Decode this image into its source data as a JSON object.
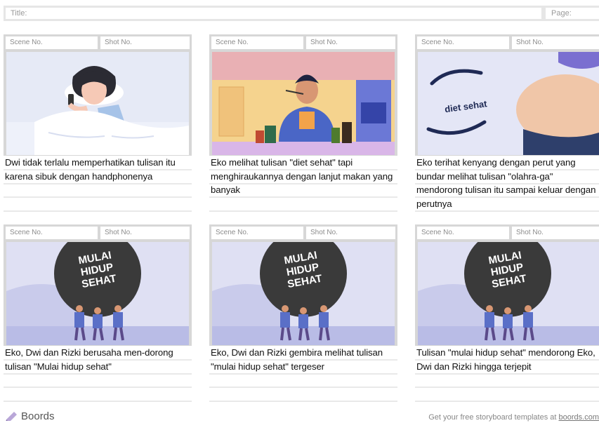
{
  "header": {
    "title_label": "Title:",
    "page_label": "Page:"
  },
  "panels": [
    {
      "scene_label": "Scene No.",
      "shot_label": "Shot No.",
      "caption": "Dwi tidak terlalu memperhatikan tulisan itu karena sibuk dengan handphonenya"
    },
    {
      "scene_label": "Scene No.",
      "shot_label": "Shot No.",
      "caption": "Eko melihat tulisan \"diet sehat\" tapi menghiraukannya dengan lanjut makan yang banyak"
    },
    {
      "scene_label": "Scene No.",
      "shot_label": "Shot No.",
      "caption": "Eko terihat kenyang dengan perut yang bundar melihat tulisan \"olahra-ga\" mendorong tulisan itu sampai keluar dengan perutnya",
      "art_text": "diet sehat"
    },
    {
      "scene_label": "Scene No.",
      "shot_label": "Shot No.",
      "caption": "Eko, Dwi dan Rizki berusaha men-dorong tulisan \"Mulai hidup sehat\"",
      "art_lines": [
        "MULAI",
        "HIDUP",
        "SEHAT"
      ]
    },
    {
      "scene_label": "Scene No.",
      "shot_label": "Shot No.",
      "caption": "Eko, Dwi dan Rizki gembira melihat tulisan \"mulai hidup sehat\" tergeser",
      "art_lines": [
        "MULAI",
        "HIDUP",
        "SEHAT"
      ]
    },
    {
      "scene_label": "Scene No.",
      "shot_label": "Shot No.",
      "caption": "Tulisan \"mulai hidup sehat\" mendorong Eko, Dwi dan Rizki hingga terjepit",
      "art_lines": [
        "MULAI",
        "HIDUP",
        "SEHAT"
      ]
    }
  ],
  "footer": {
    "brand": "Boords",
    "promo_text": "Get your free storyboard templates at ",
    "promo_link": "boords.com"
  },
  "colors": {
    "frame_border": "#d7d7d7",
    "sky": "#dfe0f3",
    "ball": "#3a3a3a",
    "shirt": "#5a6fc7"
  }
}
